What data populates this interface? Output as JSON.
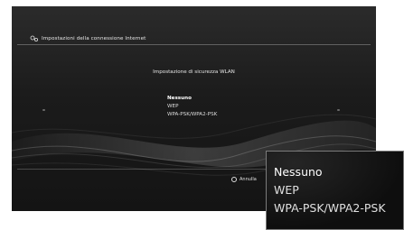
{
  "header": {
    "title": "Impostazioni della connessione Internet",
    "icon": "network-settings-icon"
  },
  "dialog": {
    "title": "Impostazione di sicurezza WLAN",
    "options": [
      "Nessuno",
      "WEP",
      "WPA-PSK/WPA2-PSK"
    ],
    "selected": "Nessuno"
  },
  "footer": {
    "cancel_label": "Annulla",
    "cancel_icon": "circle-button-icon"
  },
  "zoom_inset": {
    "options": [
      "Nessuno",
      "WEP",
      "WPA-PSK/WPA2-PSK"
    ]
  },
  "colors": {
    "background": "#1b1b1b",
    "text": "#e6e6e6",
    "selected_text": "#ffffff"
  }
}
